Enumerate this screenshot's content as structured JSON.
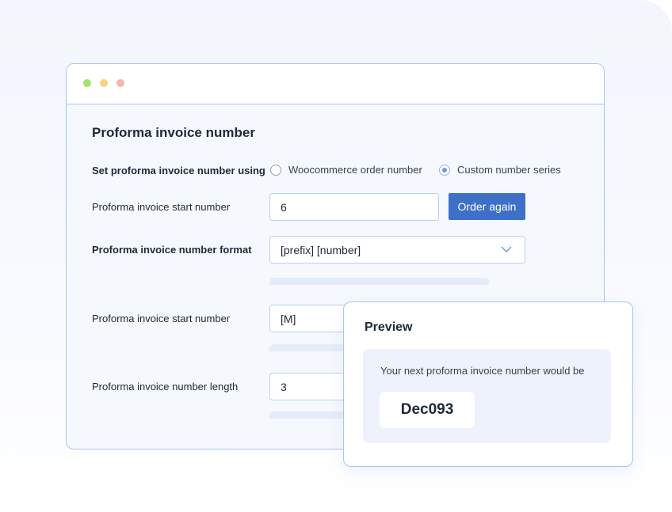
{
  "window": {
    "dots": [
      "green",
      "yellow",
      "red"
    ]
  },
  "form": {
    "title": "Proforma invoice number",
    "numbering": {
      "label": "Set proforma invoice number  using",
      "options": [
        {
          "label": "Woocommerce order number",
          "selected": false
        },
        {
          "label": "Custom number series",
          "selected": true
        }
      ]
    },
    "start_number": {
      "label": "Proforma invoice start number",
      "value": "6",
      "button_label": "Order again"
    },
    "format": {
      "label": "Proforma invoice number format",
      "value": "[prefix] [number]"
    },
    "prefix": {
      "label": "Proforma invoice start number",
      "value": "[M]"
    },
    "length": {
      "label": "Proforma invoice number length",
      "value": "3"
    }
  },
  "preview": {
    "title": "Preview",
    "description": "Your next proforma invoice number would be",
    "value": "Dec093"
  },
  "colors": {
    "accent": "#3f70c8",
    "border": "#a9c4ee",
    "panel": "#edf2fc"
  }
}
